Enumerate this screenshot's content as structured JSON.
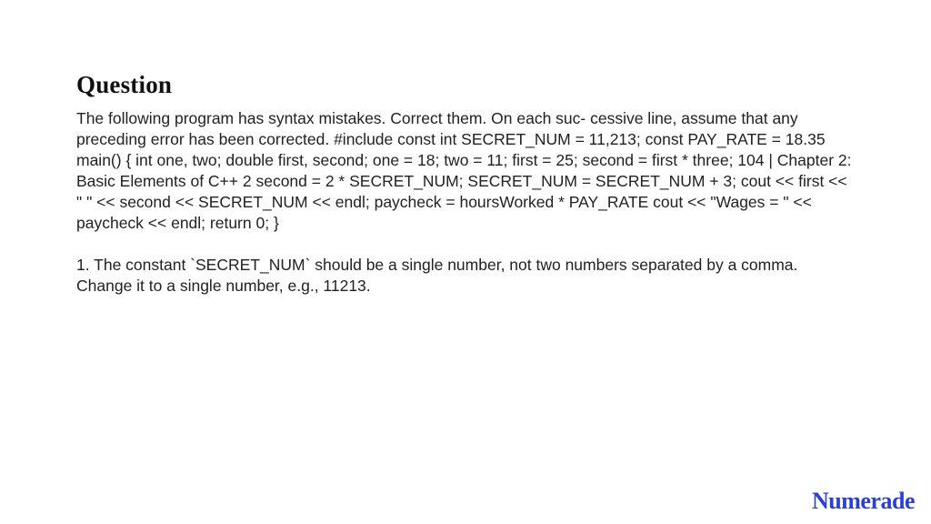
{
  "heading": "Question",
  "question_body": "The following program has syntax mistakes. Correct them. On each suc- cessive line, assume that any preceding error has been corrected. #include const int SECRET_NUM = 11,213; const PAY_RATE = 18.35 main() { int one, two; double first, second; one = 18; two = 11; first = 25; second = first * three; 104 | Chapter 2: Basic Elements of C++ 2 second = 2 * SECRET_NUM; SECRET_NUM = SECRET_NUM + 3; cout << first << \" \" << second << SECRET_NUM << endl; paycheck = hoursWorked * PAY_RATE cout << \"Wages = \" << paycheck << endl; return 0; }",
  "answer_text": "1. The constant `SECRET_NUM` should be a single number, not two numbers separated by a comma. Change it to a single number, e.g., 11213.",
  "brand": "Numerade"
}
